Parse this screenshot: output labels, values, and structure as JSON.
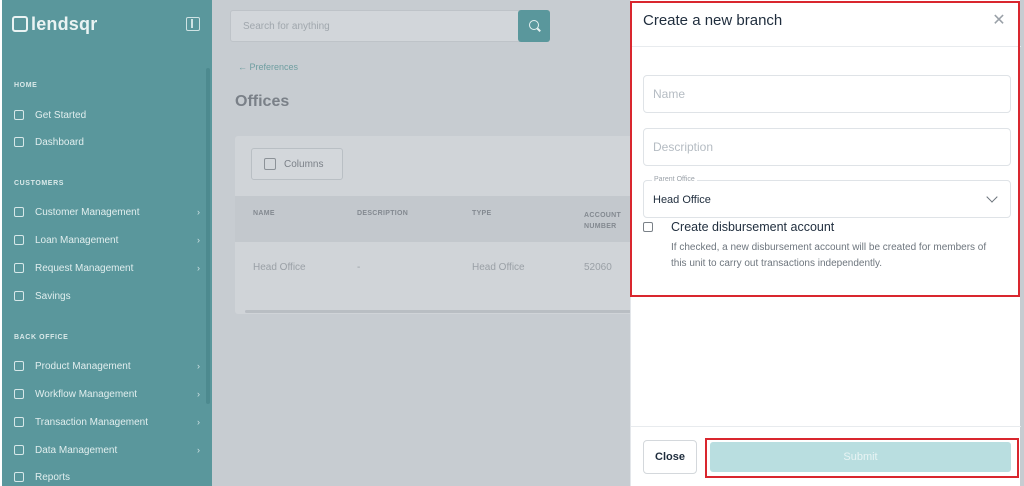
{
  "sidebar": {
    "logo": "lendsqr",
    "sections": [
      "HOME",
      "CUSTOMERS",
      "BACK OFFICE"
    ],
    "items": [
      {
        "label": "Get Started",
        "icon": "home-icon",
        "chevron": false
      },
      {
        "label": "Dashboard",
        "icon": "dashboard-icon",
        "chevron": false
      },
      {
        "label": "Customer Management",
        "icon": "users-icon",
        "chevron": true
      },
      {
        "label": "Loan Management",
        "icon": "loan-icon",
        "chevron": true
      },
      {
        "label": "Request Management",
        "icon": "request-icon",
        "chevron": true
      },
      {
        "label": "Savings",
        "icon": "savings-icon",
        "chevron": false
      },
      {
        "label": "Product Management",
        "icon": "product-icon",
        "chevron": true
      },
      {
        "label": "Workflow Management",
        "icon": "workflow-icon",
        "chevron": true
      },
      {
        "label": "Transaction Management",
        "icon": "transaction-icon",
        "chevron": true
      },
      {
        "label": "Data Management",
        "icon": "data-icon",
        "chevron": true
      },
      {
        "label": "Reports",
        "icon": "reports-icon",
        "chevron": false
      }
    ]
  },
  "main": {
    "search_placeholder": "Search for anything",
    "breadcrumb": "← Preferences",
    "title": "Offices",
    "columns_button": "Columns",
    "table": {
      "headers": [
        "NAME",
        "DESCRIPTION",
        "TYPE",
        "ACCOUNT NUMBER"
      ],
      "rows": [
        [
          "Head Office",
          "-",
          "Head Office",
          "52060"
        ]
      ]
    }
  },
  "drawer": {
    "title": "Create a new branch",
    "name_placeholder": "Name",
    "description_placeholder": "Description",
    "parent_office_label": "Parent Office",
    "parent_office_value": "Head Office",
    "checkbox_label": "Create disbursement account",
    "checkbox_help": "If checked, a new disbursement account will be created for members of this unit to carry out transactions independently.",
    "close_button": "Close",
    "submit_button": "Submit"
  },
  "colors": {
    "brand": "#5a979c",
    "overlay": "#c7ccd1",
    "submit_disabled": "#b9dee0",
    "highlight": "#d9262e"
  }
}
